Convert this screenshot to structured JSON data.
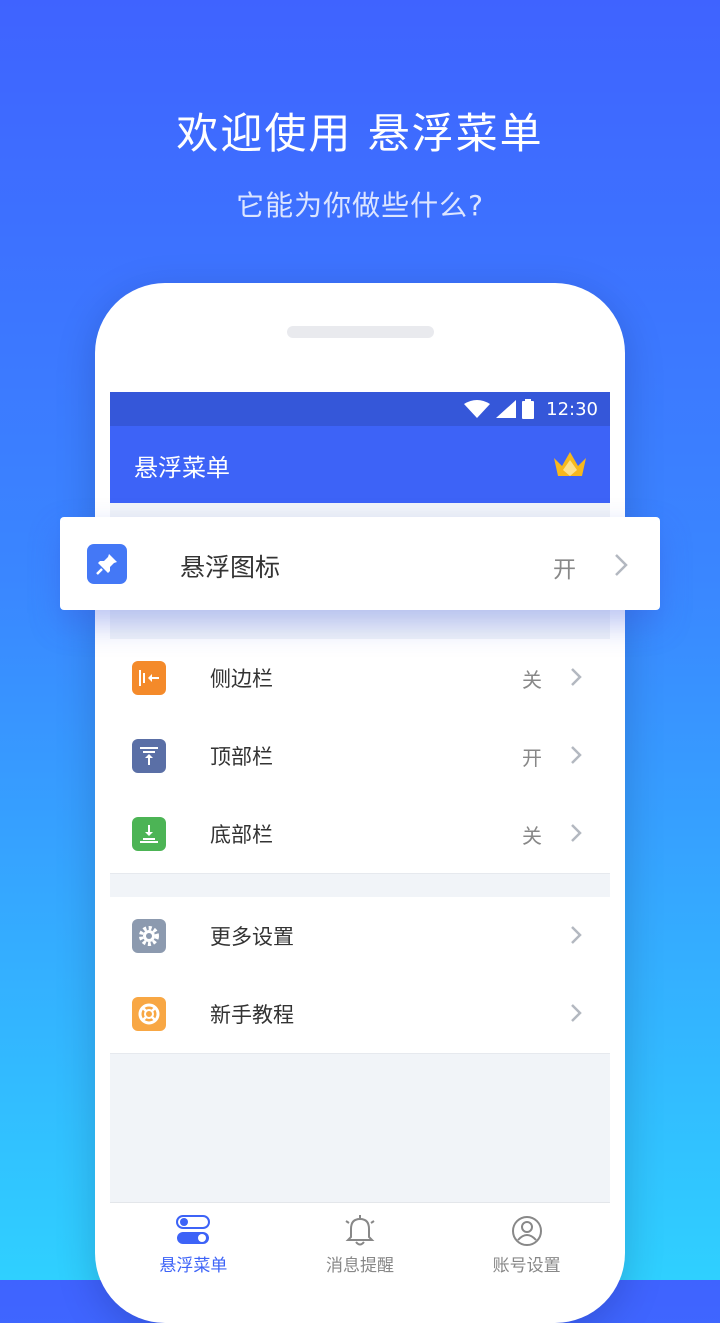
{
  "header": {
    "title": "欢迎使用 悬浮菜单",
    "subtitle": "它能为你做些什么?"
  },
  "phone": {
    "status_time": "12:30",
    "app_title": "悬浮菜单",
    "float_item": {
      "label": "悬浮图标",
      "value": "开",
      "icon": "pin-icon",
      "color": "#4478f6"
    },
    "bar_items": [
      {
        "label": "侧边栏",
        "value": "关",
        "icon": "sidebar-icon",
        "color": "#f48a2a"
      },
      {
        "label": "顶部栏",
        "value": "开",
        "icon": "topbar-icon",
        "color": "#5a6fa6"
      },
      {
        "label": "底部栏",
        "value": "关",
        "icon": "bottombar-icon",
        "color": "#4cb455"
      }
    ],
    "more_items": [
      {
        "label": "更多设置",
        "icon": "gear-icon",
        "color": "#8c9aaf"
      },
      {
        "label": "新手教程",
        "icon": "lifebuoy-icon",
        "color": "#f8a744"
      }
    ],
    "bottom_nav": [
      {
        "label": "悬浮菜单",
        "icon": "toggle-icon",
        "active": true
      },
      {
        "label": "消息提醒",
        "icon": "bell-icon",
        "active": false
      },
      {
        "label": "账号设置",
        "icon": "user-icon",
        "active": false
      }
    ]
  },
  "colors": {
    "primary": "#3d63f7",
    "status_bar": "#3557d9",
    "crown": "#f7b81d"
  }
}
